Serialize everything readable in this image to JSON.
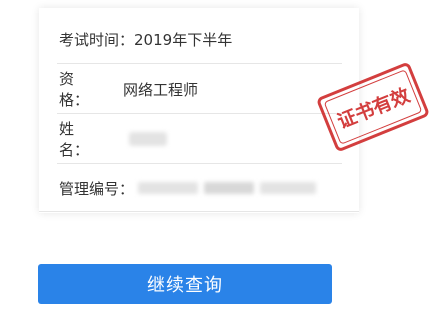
{
  "certificate": {
    "exam_time_label": "考试时间：",
    "exam_time_value": "2019年下半年",
    "qualification_label_a": "资",
    "qualification_label_b": "格：",
    "qualification_value": "网络工程师",
    "name_label_a": "姓",
    "name_label_b": "名：",
    "id_label": "管理编号："
  },
  "stamp": {
    "text": "证书有效",
    "color": "#cf2a2a"
  },
  "actions": {
    "continue_label": "继续查询"
  },
  "colors": {
    "button": "#2a83e8",
    "text": "#333333"
  }
}
